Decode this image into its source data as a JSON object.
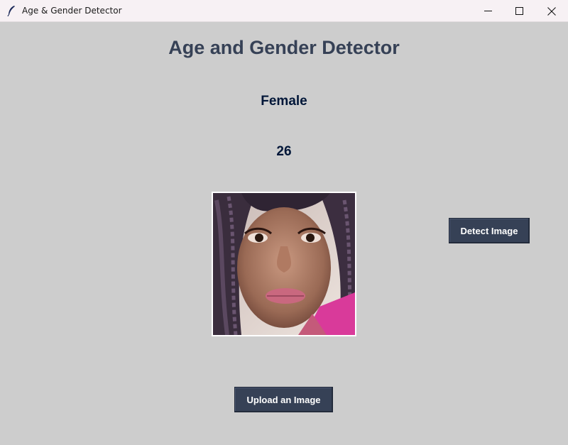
{
  "window": {
    "title": "Age & Gender Detector",
    "icon": "feather-icon",
    "controls": [
      "minimize-icon",
      "maximize-icon",
      "close-icon"
    ]
  },
  "main": {
    "heading": "Age and Gender Detector",
    "gender_result": "Female",
    "age_result": "26",
    "image": "uploaded-face-photo",
    "detect_button_label": "Detect Image",
    "upload_button_label": "Upload an Image"
  },
  "colors": {
    "background": "#cdcdcd",
    "heading": "#364156",
    "result_text": "#011638",
    "button_bg": "#364156",
    "button_text": "#ffffff"
  }
}
